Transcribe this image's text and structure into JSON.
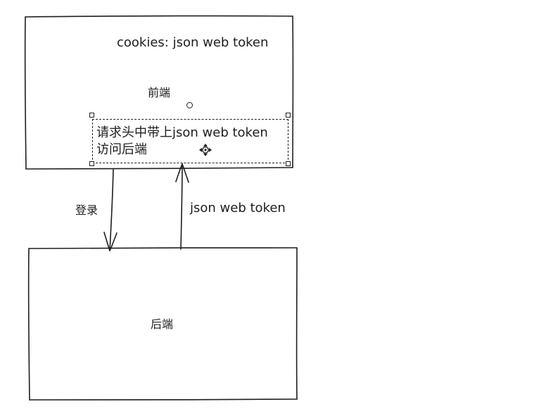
{
  "frontend": {
    "title": "前端",
    "cookie_note": "cookies: json web token",
    "request_note_line1": "请求头中带上json web token",
    "request_note_line2": "访问后端"
  },
  "backend": {
    "title": "后端"
  },
  "arrows": {
    "login_label": "登录",
    "token_label": "json web token"
  },
  "colors": {
    "stroke": "#1e1e1e",
    "background": "#ffffff"
  },
  "icons": {
    "rotate_handle": "rotate-handle-icon",
    "move_cursor": "move-cursor-icon"
  }
}
